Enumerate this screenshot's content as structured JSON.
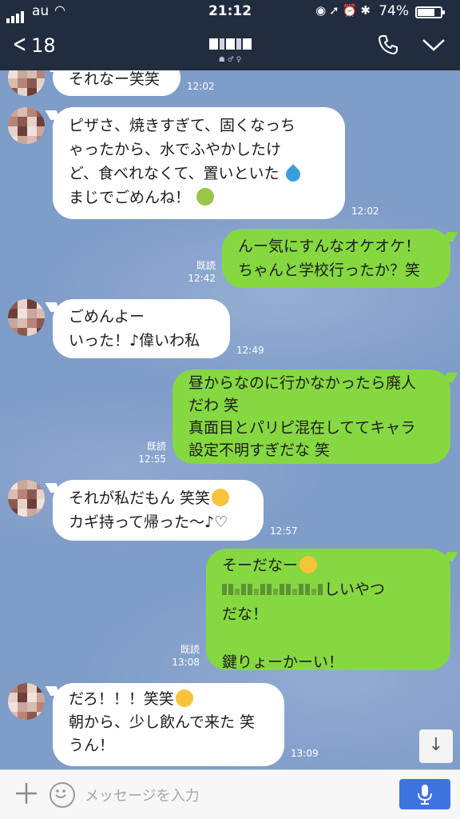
{
  "status": {
    "carrier": "au",
    "time": "21:12",
    "battery": "74%",
    "battery_level": 0.74
  },
  "header": {
    "back_count": "18",
    "title_sub": "☗ ♂ ♀"
  },
  "messages": {
    "m1": {
      "line1": "それなー笑笑",
      "time": "12:02"
    },
    "m2": {
      "line1": "ピザさ、焼きすぎて、固くなっち",
      "line2": "ゃったから、水でふやかしたけ",
      "line3": "ど、食べれなくて、置いといた",
      "line4": "まじでごめんね！",
      "time": "12:02"
    },
    "m3": {
      "line1": "んー気にすんなオケオケ！",
      "line2": "ちゃんと学校行ったか？笑",
      "read": "既読",
      "time": "12:42"
    },
    "m4": {
      "line1": "ごめんよー",
      "line2": "いった！♪偉いわ私",
      "time": "12:49"
    },
    "m5": {
      "line1": "昼からなのに行かなかったら廃人",
      "line2": "だわ 笑",
      "line3": "真面目とパリピ混在しててキャラ",
      "line4": "設定不明すぎだな 笑",
      "read": "既読",
      "time": "12:55"
    },
    "m6": {
      "line1": "それが私だもん 笑笑",
      "line2": "カギ持って帰った〜♪♡",
      "time": "12:57"
    },
    "m7": {
      "line1": "そーだなー",
      "line2": "しいやつ",
      "line3": "だな！",
      "line4": "鍵りょーかーい！",
      "read": "既読",
      "time": "13:08"
    },
    "m8": {
      "line1": "だろ！！！笑笑",
      "line2": "朝から、少し飲んで来た 笑",
      "line3": "うん！",
      "time": "13:09"
    }
  },
  "input": {
    "placeholder": "メッセージを入力"
  },
  "colors": {
    "header": "#222c3f",
    "bubble_out": "#86d841",
    "bubble_in": "#ffffff",
    "chat_bg": "#7f9dc9",
    "mic": "#3d74e0"
  },
  "icons": {
    "signal": "signal-icon",
    "wifi": "wifi-icon",
    "back": "chevron-left-icon",
    "phone": "phone-icon",
    "menu": "chevron-down-icon",
    "plus": "plus-icon",
    "emoji": "emoji-icon",
    "mic": "microphone-icon",
    "scroll": "arrow-down-icon"
  }
}
